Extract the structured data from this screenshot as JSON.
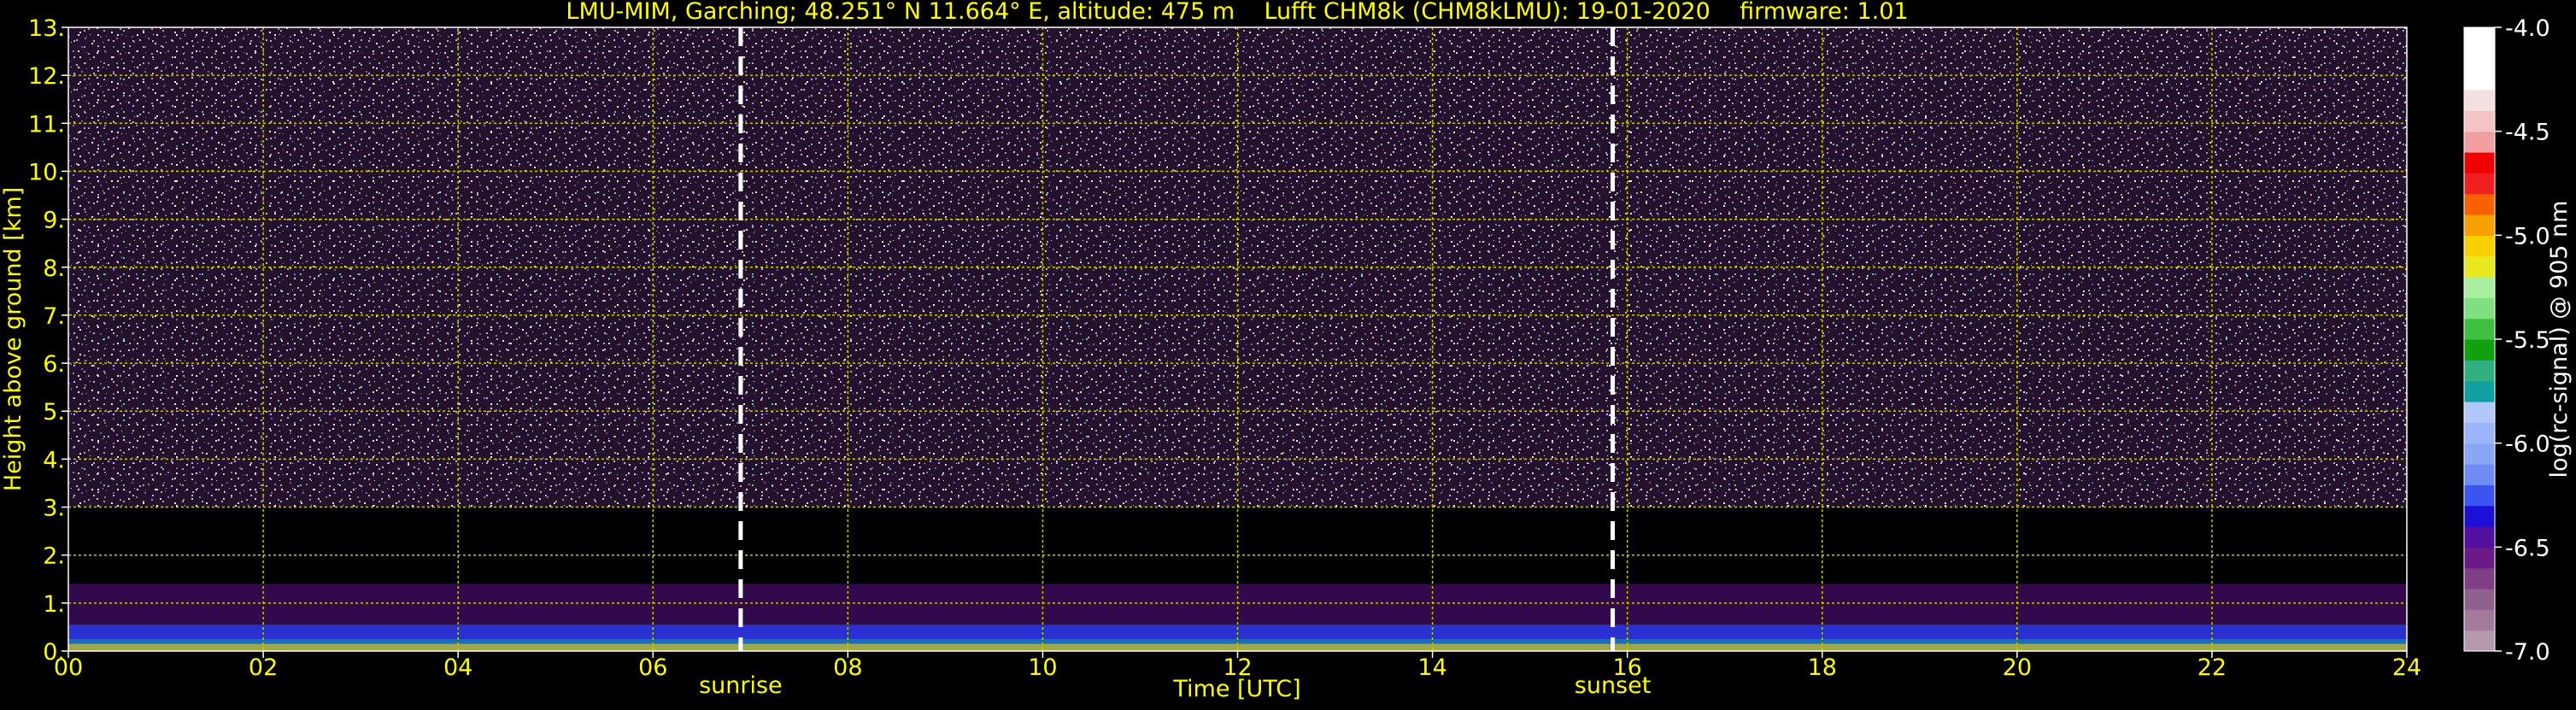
{
  "chart_data": {
    "type": "heatmap",
    "title": "LMU-MIM, Garching; 48.251° N 11.664° E, altitude: 475 m    Lufft CHM8k (CHM8kLMU): 19-01-2020    firmware: 1.01",
    "xlabel": "Time [UTC]",
    "ylabel": "Height above ground [km]",
    "xlim": [
      0,
      24
    ],
    "ylim": [
      0,
      13
    ],
    "x_ticks": [
      0,
      2,
      4,
      6,
      8,
      10,
      12,
      14,
      16,
      18,
      20,
      22,
      24
    ],
    "x_tick_labels": [
      "00",
      "02",
      "04",
      "06",
      "08",
      "10",
      "12",
      "14",
      "16",
      "18",
      "20",
      "22",
      "24"
    ],
    "y_ticks": [
      0,
      1,
      2,
      3,
      4,
      5,
      6,
      7,
      8,
      9,
      10,
      11,
      12,
      13
    ],
    "y_tick_labels": [
      "0.",
      "1.",
      "2.",
      "3.",
      "4.",
      "5.",
      "6.",
      "7.",
      "8.",
      "9.",
      "10.",
      "11.",
      "12.",
      "13."
    ],
    "grid": true,
    "annotations": [
      {
        "label": "sunrise",
        "x": 6.9
      },
      {
        "label": "sunset",
        "x": 15.85
      }
    ],
    "colorbar": {
      "label": "log(rc-signal) @ 905 nm",
      "range": [
        -7.0,
        -4.0
      ],
      "ticks": [
        -4.0,
        -4.5,
        -5.0,
        -5.5,
        -6.0,
        -6.5,
        -7.0
      ],
      "tick_labels": [
        "-4.0",
        "-4.5",
        "-5.0",
        "-5.5",
        "-6.0",
        "-6.5",
        "-7.0"
      ],
      "colors": [
        "#b49aac",
        "#a27a9c",
        "#90608e",
        "#7e3f84",
        "#6a1a86",
        "#5210a0",
        "#1a10d8",
        "#3a55f0",
        "#6f8cf4",
        "#8aa6f6",
        "#9ab6f8",
        "#b2c8fa",
        "#10a0a0",
        "#30b080",
        "#10a010",
        "#40c040",
        "#80e080",
        "#a8f0a0",
        "#e8e820",
        "#f8d000",
        "#f8a000",
        "#f86000",
        "#f02020",
        "#f00000",
        "#f0a0a0",
        "#f4c4c4",
        "#f4e0e0",
        "#ffffff",
        "#ffffff",
        "#ffffff"
      ]
    },
    "colors": {
      "text": "#ffff00",
      "grid": "#c8c800",
      "sun_lines": "#ffffff",
      "background": "#000000"
    }
  }
}
